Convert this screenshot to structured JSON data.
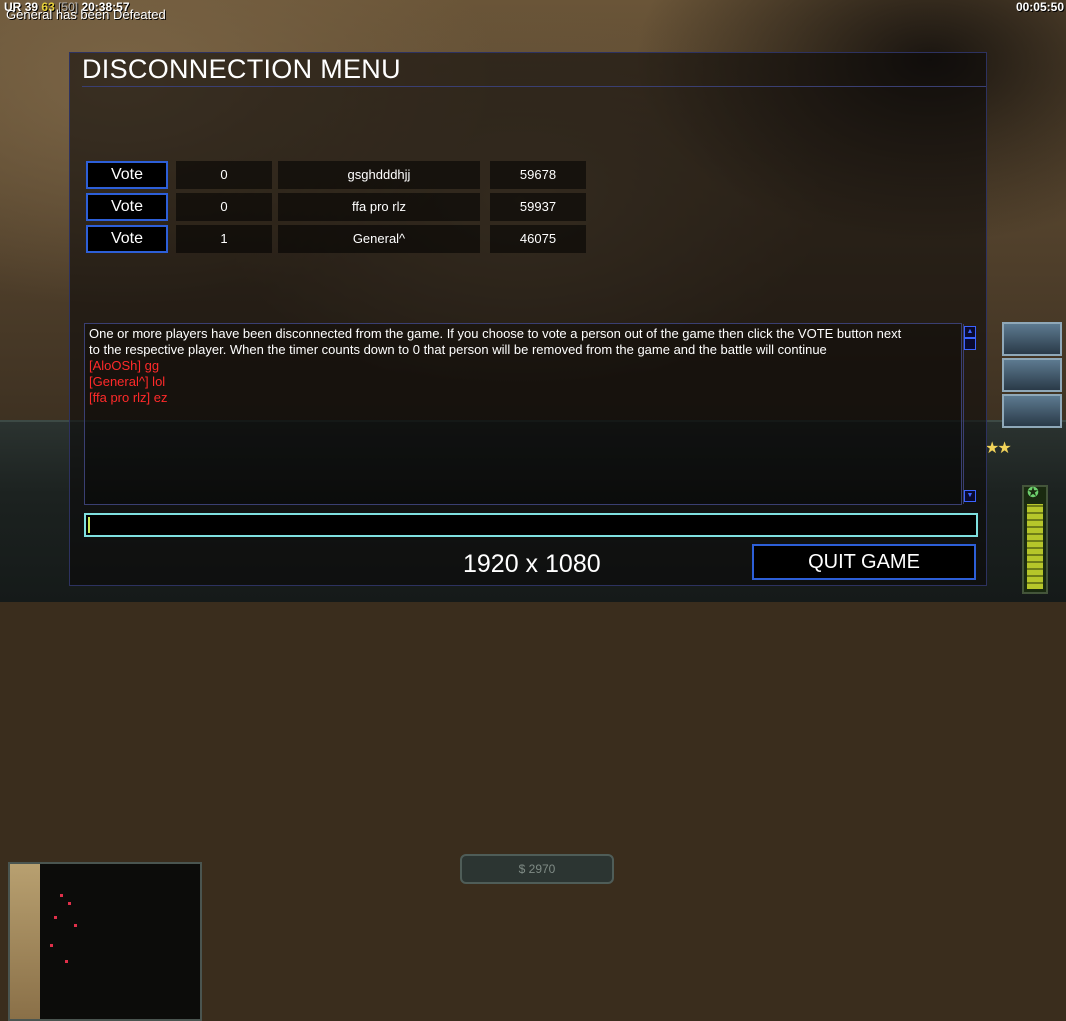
{
  "hud": {
    "ping_values": [
      "UR",
      "39",
      "63",
      "[50]"
    ],
    "clock": "20:38:57",
    "defeat_message": "General has been Defeated",
    "game_timer": "00:05:50",
    "money": "$ 2970",
    "resolution_overlay": "1920 x 1080"
  },
  "dialog": {
    "title": "DISCONNECTION MENU",
    "vote_label": "Vote",
    "players": [
      {
        "votes": "0",
        "name": "gsghdddhjj",
        "id": "59678"
      },
      {
        "votes": "0",
        "name": "ffa pro rlz",
        "id": "59937"
      },
      {
        "votes": "1",
        "name": "General^",
        "id": "46075"
      }
    ],
    "chat": [
      {
        "text": "One or more players have been disconnected from the game. If you choose to vote a person out of the game then click the VOTE button next",
        "color": "#ffffff"
      },
      {
        "text": " to the respective player. When the timer counts down to 0 that person will be removed from the game and the battle will continue",
        "color": "#ffffff"
      },
      {
        "text": "[AloOSh] gg",
        "color": "#ff2a2a"
      },
      {
        "text": "[General^] lol",
        "color": "#ff2a2a"
      },
      {
        "text": "[ffa pro rlz] ez",
        "color": "#ff2a2a"
      }
    ],
    "chat_input_value": "",
    "quit_label": "QUIT GAME"
  },
  "colors": {
    "button_border": "#2d5fd8",
    "chat_system": "#ffffff",
    "chat_player": "#ff2a2a",
    "input_border": "#7fe0e0"
  }
}
